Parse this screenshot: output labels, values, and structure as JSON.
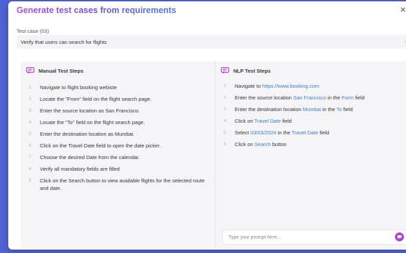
{
  "modal": {
    "title": "Generate test cases from requirements",
    "close_icon": "close-icon"
  },
  "test_case": {
    "label": "Test case (03)",
    "value": "Verify that users can search for flights"
  },
  "manual": {
    "header": "Manual Test Steps",
    "steps": [
      {
        "num": "1",
        "text": "Navigate to flight booking webiste"
      },
      {
        "num": "2",
        "text": "Locate the \"From\" field on the flight search page."
      },
      {
        "num": "3",
        "text": "Enter the source location as San Francisco."
      },
      {
        "num": "4",
        "text": "Locate the \"To\" field on the flight search page."
      },
      {
        "num": "5",
        "text": "Enter the destination location as Mumbai."
      },
      {
        "num": "6",
        "text": "Click on the Travel Date field to open the date picker."
      },
      {
        "num": "7",
        "text": "Choose the desired Date from the calendar."
      },
      {
        "num": "8",
        "text": "Verify all mandatory fields are filled"
      },
      {
        "num": "9",
        "text": "Click on the Search button to view available flights for the selected route and date."
      }
    ]
  },
  "nlp": {
    "header": "NLP Test Steps",
    "steps": [
      {
        "num": "1",
        "parts": [
          {
            "t": "Navigate to ",
            "hl": false
          },
          {
            "t": "https://www.booking.com",
            "hl": true
          }
        ]
      },
      {
        "num": "2",
        "parts": [
          {
            "t": "Enter the source location ",
            "hl": false
          },
          {
            "t": "San Francisco",
            "hl": true
          },
          {
            "t": " in the ",
            "hl": false
          },
          {
            "t": "Form",
            "hl": true
          },
          {
            "t": " field",
            "hl": false
          }
        ]
      },
      {
        "num": "3",
        "parts": [
          {
            "t": "Enter the destination location ",
            "hl": false
          },
          {
            "t": "Mumbai",
            "hl": true
          },
          {
            "t": " in the ",
            "hl": false
          },
          {
            "t": "To",
            "hl": true
          },
          {
            "t": " field",
            "hl": false
          }
        ]
      },
      {
        "num": "4",
        "parts": [
          {
            "t": "Click on ",
            "hl": false
          },
          {
            "t": "Travel Date",
            "hl": true
          },
          {
            "t": " field",
            "hl": false
          }
        ]
      },
      {
        "num": "5",
        "parts": [
          {
            "t": "Select ",
            "hl": false
          },
          {
            "t": "03/03/2024",
            "hl": true
          },
          {
            "t": " in the ",
            "hl": false
          },
          {
            "t": "Travel Date",
            "hl": true
          },
          {
            "t": " field",
            "hl": false
          }
        ]
      },
      {
        "num": "6",
        "parts": [
          {
            "t": "Click on ",
            "hl": false
          },
          {
            "t": "Search",
            "hl": true
          },
          {
            "t": " button",
            "hl": false
          }
        ]
      }
    ],
    "prompt_placeholder": "Type your prompt here..."
  },
  "colors": {
    "accent_purple": "#b43fd6",
    "link_blue": "#3a7bd5",
    "backdrop": "#4f63d6"
  }
}
